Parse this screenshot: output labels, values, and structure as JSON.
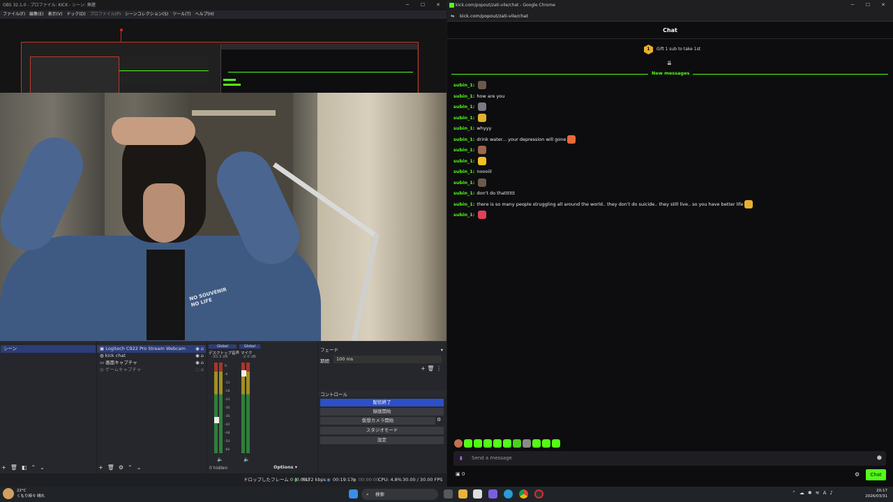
{
  "obs": {
    "title": "OBS 32.1.0 - プロファイル: KICK - シーン: 無題",
    "menu": [
      "ファイル(F)",
      "編集(E)",
      "表示(V)",
      "ドック(D)",
      "プロファイル(P)",
      "シーンコレクション(S)",
      "ツール(T)",
      "ヘルプ(H)"
    ],
    "scenes": {
      "items": [
        "シーン"
      ]
    },
    "sources": {
      "items": [
        {
          "label": "Logitech C922 Pro Stream Webcam",
          "icon": "camera-icon"
        },
        {
          "label": "kick chat",
          "icon": "globe-icon"
        },
        {
          "label": "画面キャプチャ",
          "icon": "monitor-icon"
        },
        {
          "label": "ゲームキャプチャ",
          "icon": "gamepad-icon"
        }
      ]
    },
    "mixer": {
      "channels": [
        {
          "tag": "Global",
          "name": "デスクトップ音声",
          "db": "-30.3 dB"
        },
        {
          "tag": "Global",
          "name": "マイク",
          "db": "-2.0 dB"
        }
      ],
      "scale": [
        "0",
        "-6",
        "-12",
        "-18",
        "-24",
        "-30",
        "-36",
        "-42",
        "-48",
        "-54",
        "-60"
      ],
      "hidden": "0 hidden",
      "options": "Options"
    },
    "transition": {
      "type": "フェード",
      "duration_label": "期間",
      "duration": "100 ms"
    },
    "controls": {
      "title": "コントロール",
      "buttons": [
        "配信終了",
        "録画開始",
        "仮想カメラ開始",
        "スタジオモード",
        "設定"
      ]
    },
    "status": {
      "dropped": "ドロップしたフレーム 0 (0.0%)",
      "bitrate": "6172 kbps",
      "stream_time": "00:19:17",
      "rec_time": "00:00:00",
      "cpu": "CPU: 4.8%",
      "fps": "30.00 / 30.00 FPS"
    },
    "webcam_text": [
      "NO SOUVENIR",
      "NO LIFE"
    ]
  },
  "chrome": {
    "title": "kick.com/popout/zati-vile/chat - Google Chrome",
    "url": "kick.com/popout/zati-vile/chat",
    "chat": {
      "header": "Chat",
      "gift_badge": "1",
      "gift_text": "Gift 1 sub to take 1st",
      "new_messages": "New messages",
      "messages": [
        {
          "user": "subin_1:",
          "text": "",
          "emote": "#6b5a4a"
        },
        {
          "user": "subin_1:",
          "text": "how are you",
          "emote": ""
        },
        {
          "user": "subin_1:",
          "text": "",
          "emote": "#7a7a86"
        },
        {
          "user": "subin_1:",
          "text": "",
          "emote": "#e0b030"
        },
        {
          "user": "subin_1:",
          "text": "whyyy",
          "emote": ""
        },
        {
          "user": "subin_1:",
          "text": "drink water... your depression will gone",
          "emote": "#e86a3a"
        },
        {
          "user": "subin_1:",
          "text": "",
          "emote": "#a0654a"
        },
        {
          "user": "subin_1:",
          "text": "",
          "emote": "#f0c020"
        },
        {
          "user": "subin_1:",
          "text": "noooiil",
          "emote": ""
        },
        {
          "user": "subin_1:",
          "text": "",
          "emote": "#6b5a4a"
        },
        {
          "user": "subin_1:",
          "text": "don't do thatttttt",
          "emote": ""
        },
        {
          "user": "subin_1:",
          "text": "there is so many people struggling all around the world.. they don't do suicide.. they still live.. so you have better life",
          "emote": "#e8b030"
        },
        {
          "user": "subin_1:",
          "text": "",
          "emote": "#e0405a"
        }
      ],
      "input_placeholder": "Send a message",
      "viewer_count": "0",
      "chat_button": "Chat"
    }
  },
  "taskbar": {
    "weather_temp": "22°C",
    "weather_text": "くもり時々 晴れ",
    "search": "検索",
    "time": "20:17",
    "date": "2026/03/31"
  }
}
